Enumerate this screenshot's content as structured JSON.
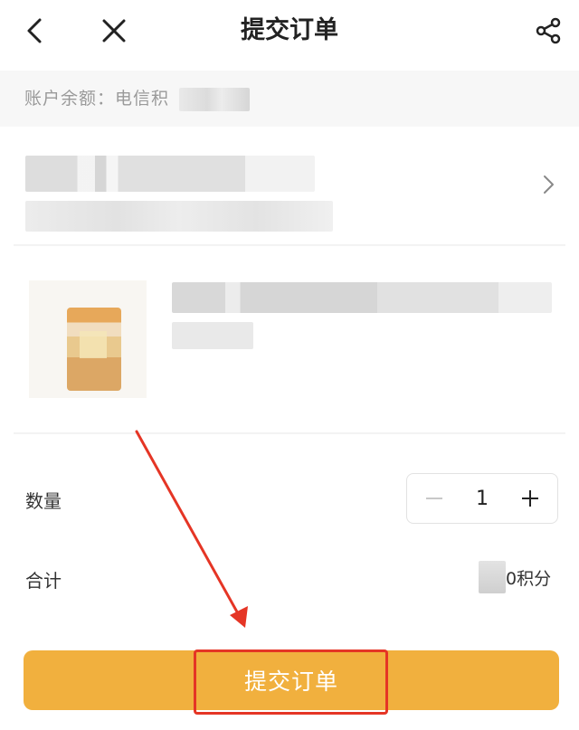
{
  "header": {
    "title": "提交订单",
    "back_icon": "chevron-left-icon",
    "close_icon": "close-icon",
    "share_icon": "share-icon"
  },
  "balance": {
    "label": "账户余额：电信积"
  },
  "address": {
    "chevron_icon": "chevron-right-icon"
  },
  "order": {
    "quantity_label": "数量",
    "quantity_value": "1",
    "total_label": "合计",
    "total_value": "0积分"
  },
  "submit": {
    "label": "提交订单"
  },
  "colors": {
    "accent": "#f1b03e",
    "annotation": "#e53525",
    "balance_bg": "#f7f7f7"
  }
}
